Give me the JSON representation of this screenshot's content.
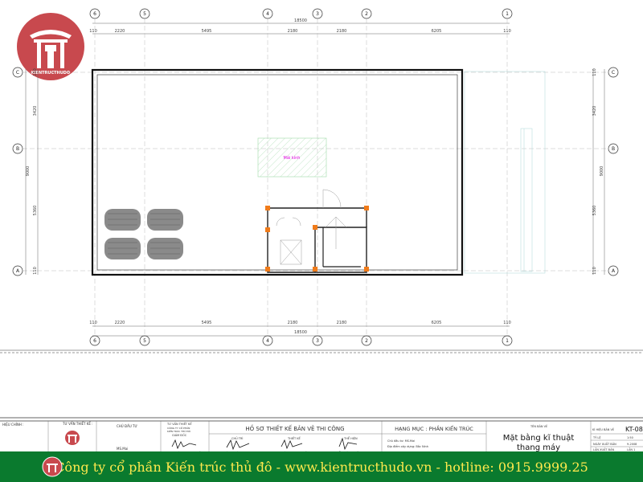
{
  "logo": {
    "caption": "KIENTRUCTHUDO"
  },
  "grid": {
    "top_axes": [
      "6",
      "5",
      "4",
      "3",
      "2",
      "1"
    ],
    "side_axes": [
      "C",
      "B",
      "A"
    ],
    "overall": "18500",
    "spans": [
      "110",
      "2220",
      "5495",
      "2180",
      "2180",
      "6205",
      "110"
    ],
    "left_dims": [
      "110",
      "3420",
      "9000",
      "5360",
      "110"
    ],
    "right_dims": [
      "110",
      "3420",
      "9000",
      "5360",
      "110"
    ]
  },
  "plan": {
    "skylight_label": "Mái kính"
  },
  "title_block": {
    "revision": "HIỆU CHỈNH :",
    "consultant": "TƯ VẤN THIẾT KẾ :",
    "investor": "CHỦ ĐẦU TƯ",
    "investor_name": "MS.Mai",
    "design_firm": "TƯ VẤN THIẾT KẾ",
    "firm_line1": "CÔNG TY CỔ PHẦN",
    "firm_line2": "KIẾN TRÚC THỦ ĐÔ",
    "director_role": "GIÁM ĐỐC",
    "director": "KTS.HOÀNG VĨNH HIỀN",
    "project": "HỒ SƠ THIẾT KẾ BẢN VẼ THI CÔNG",
    "chief_role": "CHỦ TRÌ",
    "chief": "KTS.HOÀNG ĐÌNH NGHĨA",
    "designer_role": "THIẾT KẾ",
    "designer": "KTS.HOÀNG VĨNH HIỀN",
    "drafter_role": "THỂ HIỆN",
    "drafter": "NGUYỄN VĂN THẮNG",
    "category": "HẠNG MỤC : PHẦN KIẾN TRÚC",
    "owner_line": "Chủ đầu tư: MS.Mai",
    "location_line": "Địa điểm xây dựng: Bắc Ninh",
    "sheet_name_label": "TÊN BẢN VẼ",
    "sheet_title_1": "Mặt bằng kĩ thuật",
    "sheet_title_2": "thang máy",
    "sheet_no_label": "KÍ HIỆU BẢN VẼ",
    "sheet_no": "KT-08",
    "scale_label": "TỶ LỆ",
    "scale": "1:50",
    "date_label": "NGÀY XUẤT BẢN",
    "date": "9-2008",
    "issue_label": "LẦN XUẤT BẢN",
    "issue": "LẦN 1"
  },
  "footer": {
    "text": "Công ty cổ phần Kiến trúc thủ đô - www.kientructhudo.vn - hotline: 0915.9999.25"
  },
  "colors": {
    "footer_bg": "#0a7a2e",
    "footer_text": "#ffe94d",
    "logo_red": "#c8494e",
    "column": "#f07b1a",
    "label_magenta": "#e000e0"
  }
}
